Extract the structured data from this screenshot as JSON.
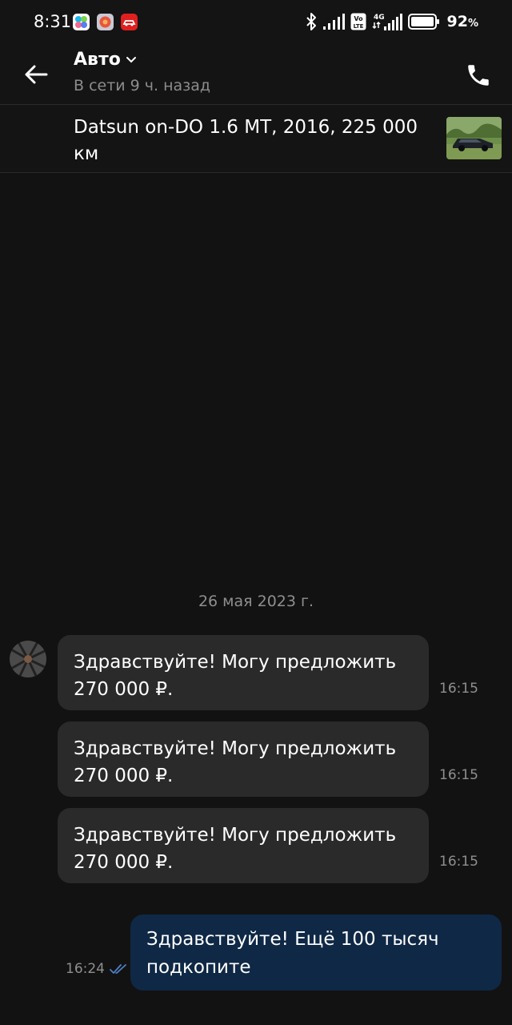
{
  "status_bar": {
    "time": "8:31",
    "battery": "92",
    "network": "4G",
    "volte_top": "Vo",
    "volte_bottom": "LTE",
    "icons": [
      "bluetooth-icon",
      "signal-icon",
      "volte-icon",
      "4g-signal-icon",
      "battery-icon"
    ]
  },
  "header": {
    "title": "Авто",
    "subtitle": "В сети 9 ч. назад"
  },
  "listing": {
    "title": "Datsun on-DO 1.6  MT, 2016, 225 000 км"
  },
  "chat": {
    "date": "26 мая 2023 г.",
    "incoming": [
      {
        "text": "Здравствуйте! Могу предложить 270 000 ₽.",
        "time": "16:15"
      },
      {
        "text": "Здравствуйте! Могу предложить 270 000 ₽.",
        "time": "16:15"
      },
      {
        "text": "Здравствуйте! Могу предложить 270 000 ₽.",
        "time": "16:15"
      }
    ],
    "outgoing": [
      {
        "text": "Здравствуйте! Ещё 100 тысяч подкопите",
        "time": "16:24",
        "status": "read"
      }
    ]
  },
  "colors": {
    "background": "#121212",
    "incoming_bubble": "#2a2a2a",
    "outgoing_bubble": "#0f2846",
    "read_checks": "#4d7fc4"
  }
}
